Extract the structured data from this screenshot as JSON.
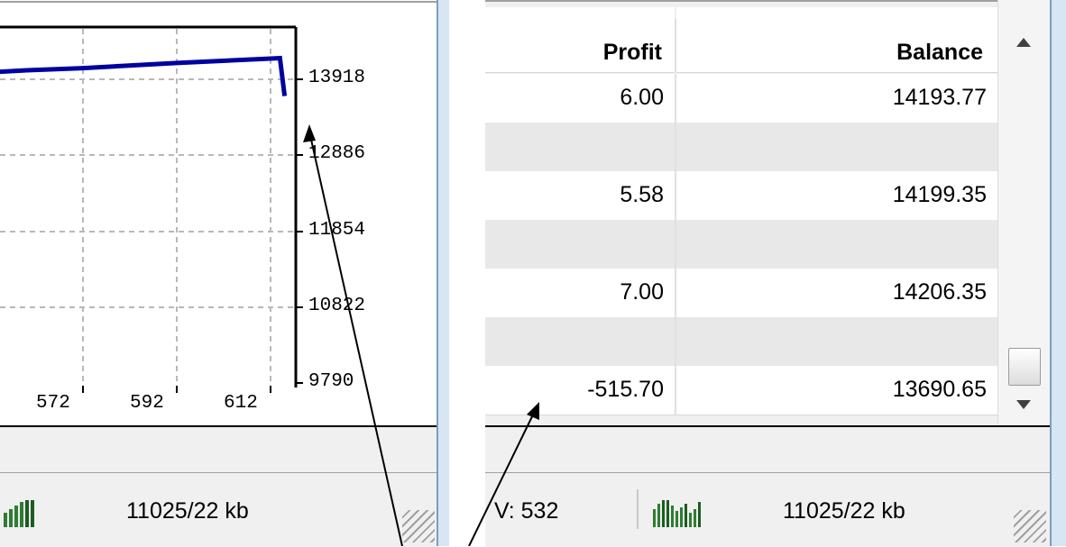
{
  "chart": {
    "y_ticks": [
      "13918",
      "12886",
      "11854",
      "10822",
      "9790"
    ],
    "x_ticks": [
      "572",
      "592",
      "612"
    ],
    "line_color": "#0000a0"
  },
  "chart_data": {
    "type": "line",
    "title": "",
    "xlabel": "",
    "ylabel": "",
    "x_ticks": [
      572,
      592,
      612
    ],
    "y_ticks": [
      13918,
      12886,
      11854,
      10822,
      9790
    ],
    "ylim": [
      9790,
      14400
    ],
    "grid": true,
    "series": [
      {
        "values": [
          {
            "x": 546,
            "y": 13990
          },
          {
            "x": 560,
            "y": 14040
          },
          {
            "x": 572,
            "y": 14070
          },
          {
            "x": 592,
            "y": 14140
          },
          {
            "x": 612,
            "y": 14200
          },
          {
            "x": 614,
            "y": 14206
          },
          {
            "x": 615,
            "y": 13690
          }
        ]
      }
    ]
  },
  "left_status": {
    "size_text": "11025/22 kb",
    "icon": "connection-bars-icon"
  },
  "table": {
    "columns": [
      "Profit",
      "Balance"
    ],
    "rows": [
      {
        "profit": "6.00",
        "balance": "14193.77"
      },
      {
        "profit": "",
        "balance": ""
      },
      {
        "profit": "5.58",
        "balance": "14199.35"
      },
      {
        "profit": "",
        "balance": ""
      },
      {
        "profit": "7.00",
        "balance": "14206.35"
      },
      {
        "profit": "",
        "balance": ""
      },
      {
        "profit": "-515.70",
        "balance": "13690.65"
      }
    ]
  },
  "right_status": {
    "v_text": "V: 532",
    "size_text": "11025/22 kb",
    "icon": "connection-bars-icon"
  },
  "scroll_icons": [
    "scroll-up-icon",
    "scroll-down-icon"
  ]
}
